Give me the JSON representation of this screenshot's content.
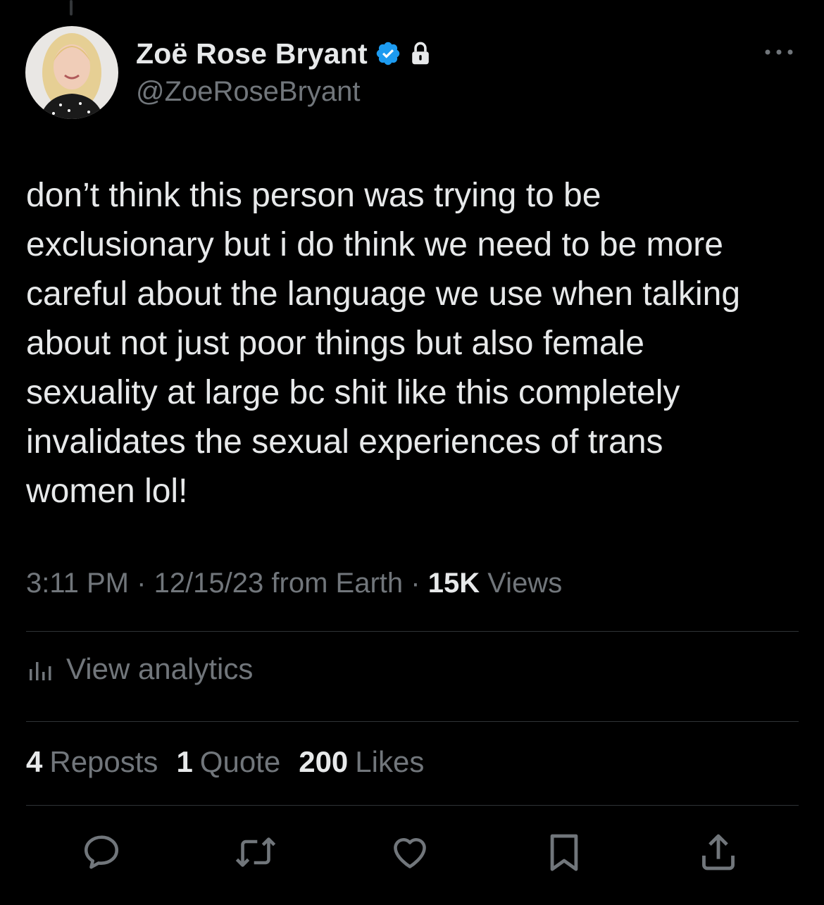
{
  "author": {
    "display_name": "Zoë Rose Bryant",
    "handle": "@ZoeRoseBryant",
    "verified": true,
    "protected": true
  },
  "tweet": {
    "text": "don’t think this person was trying to be\nexclusionary but i do think we need to be more\ncareful about the language we use when talking\nabout not just poor things but also female\nsexuality at large bc shit like this completely\ninvalidates the sexual experiences of trans\nwomen lol!",
    "time": "3:11 PM",
    "separator": "·",
    "date": "12/15/23",
    "source": "from Earth",
    "views_count": "15K",
    "views_label": "Views"
  },
  "analytics": {
    "label": "View analytics"
  },
  "stats": {
    "reposts_count": "4",
    "reposts_label": "Reposts",
    "quotes_count": "1",
    "quotes_label": "Quote",
    "likes_count": "200",
    "likes_label": "Likes"
  },
  "icons": {
    "verified": "verified-badge-icon",
    "protected": "lock-icon",
    "more": "more-dots-icon",
    "analytics": "bar-chart-icon",
    "reply": "reply-icon",
    "repost": "repost-icon",
    "like": "heart-icon",
    "bookmark": "bookmark-icon",
    "share": "share-icon"
  },
  "colors": {
    "background": "#000000",
    "text_primary": "#e7e9ea",
    "text_secondary": "#71767b",
    "verified_blue": "#1d9bf0",
    "divider": "#2f3336"
  }
}
